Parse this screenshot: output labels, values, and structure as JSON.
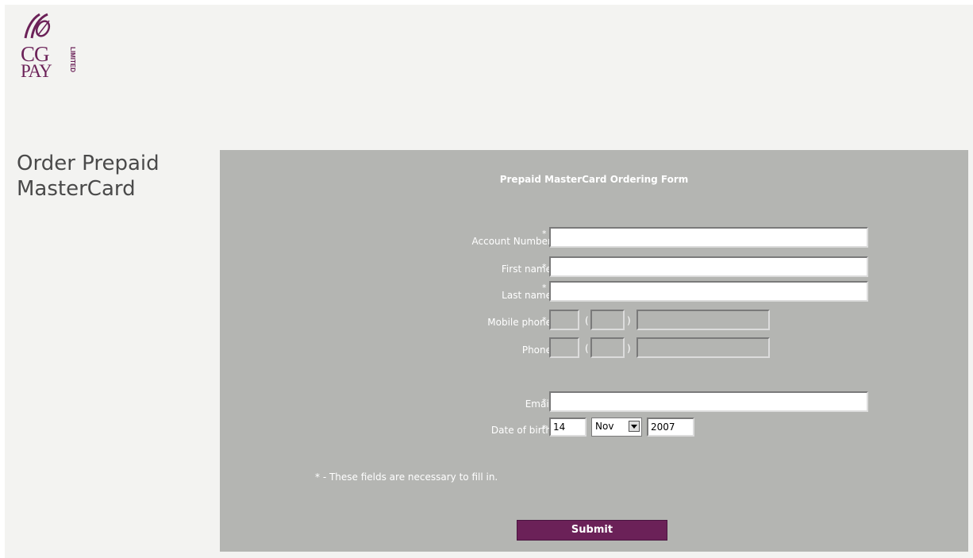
{
  "logo": {
    "line1": "CG",
    "line2": "PAY",
    "limited": "LIMITED"
  },
  "page_title": "Order Prepaid MasterCard",
  "form": {
    "title": "Prepaid MasterCard Ordering Form",
    "required_mark": "*",
    "fields": {
      "account_number": {
        "label": "Account Number",
        "value": ""
      },
      "first_name": {
        "label": "First name",
        "value": ""
      },
      "last_name": {
        "label": "Last name",
        "value": ""
      },
      "mobile_phone": {
        "label": "Mobile phone",
        "open_paren": "(",
        "close_paren": ")",
        "part1": "",
        "part2": "",
        "part3": ""
      },
      "phone": {
        "label": "Phone",
        "open_paren": "(",
        "close_paren": ")",
        "part1": "",
        "part2": "",
        "part3": ""
      },
      "email": {
        "label": "Email",
        "value": ""
      },
      "date_of_birth": {
        "label": "Date of birth",
        "day": "14",
        "month": "Nov",
        "year": "2007"
      }
    },
    "note": "* - These fields are necessary to fill in.",
    "submit_label": "Submit"
  },
  "colors": {
    "brand": "#6b2158",
    "panel": "#b4b5b2",
    "background": "#f3f3f1"
  }
}
